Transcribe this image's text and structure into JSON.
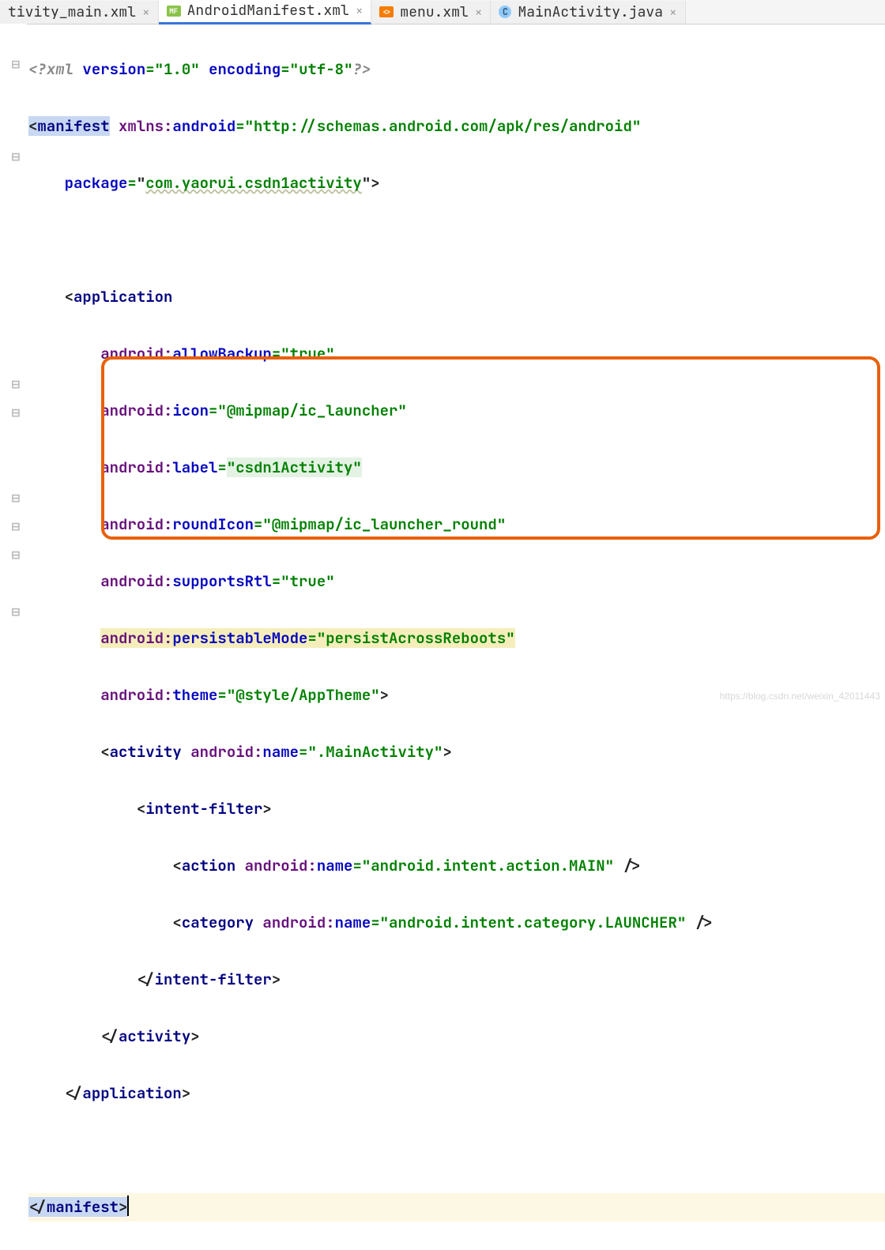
{
  "tabs": {
    "t0": {
      "label": "tivity_main.xml"
    },
    "t1": {
      "label": "AndroidManifest.xml"
    },
    "t2": {
      "label": "menu.xml"
    },
    "t3": {
      "label": "MainActivity.java"
    }
  },
  "code": {
    "xmlDecl": {
      "open": "<?",
      "xml": "xml",
      "versionAttr": "version",
      "versionVal": "\"1.0\"",
      "encAttr": "encoding",
      "encVal": "\"utf-8\"",
      "close": "?>"
    },
    "manifest": {
      "open": "<",
      "name": "manifest",
      "xmlnsNs": "xmlns:",
      "xmlnsLocal": "android",
      "xmlnsVal": "\"http://schemas.android.com/apk/res/android\"",
      "pkgAttr": "package",
      "pkgVal": "\"com.yaorui.csdn1activity\"",
      "closeOpen": "</",
      "closeName": "manifest",
      "gt": ">"
    },
    "app": {
      "open": "<",
      "name": "application",
      "allowBackup": {
        "ns": "android:",
        "attr": "allowBackup",
        "val": "\"true\""
      },
      "icon": {
        "ns": "android:",
        "attr": "icon",
        "val": "\"@mipmap/ic_launcher\""
      },
      "label": {
        "ns": "android:",
        "attr": "label",
        "val": "\"csdn1Activity\""
      },
      "roundIcon": {
        "ns": "android:",
        "attr": "roundIcon",
        "val": "\"@mipmap/ic_launcher_round\""
      },
      "supportsRtl": {
        "ns": "android:",
        "attr": "supportsRtl",
        "val": "\"true\""
      },
      "persist": {
        "ns": "android:",
        "attr": "persistableMode",
        "val": "\"persistAcrossReboots\""
      },
      "theme": {
        "ns": "android:",
        "attr": "theme",
        "val": "\"@style/AppTheme\""
      },
      "gt": ">",
      "closeOpen": "</",
      "closeName": "application"
    },
    "activity": {
      "open": "<",
      "name": "activity",
      "ns": "android:",
      "attr": "name",
      "val": "\".MainActivity\"",
      "gt": ">",
      "closeOpen": "</",
      "closeName": "activity"
    },
    "intent": {
      "open": "<",
      "name": "intent-filter",
      "gt": ">",
      "closeOpen": "</",
      "closeName": "intent-filter"
    },
    "action": {
      "open": "<",
      "name": "action",
      "ns": "android:",
      "attr": "name",
      "val": "\"android.intent.action.MAIN\"",
      "selfclose": " />"
    },
    "category": {
      "open": "<",
      "name": "category",
      "ns": "android:",
      "attr": "name",
      "val": "\"android.intent.category.LAUNCHER\"",
      "selfclose": " />"
    }
  },
  "watermark": "https://blog.csdn.net/weixin_42011443"
}
